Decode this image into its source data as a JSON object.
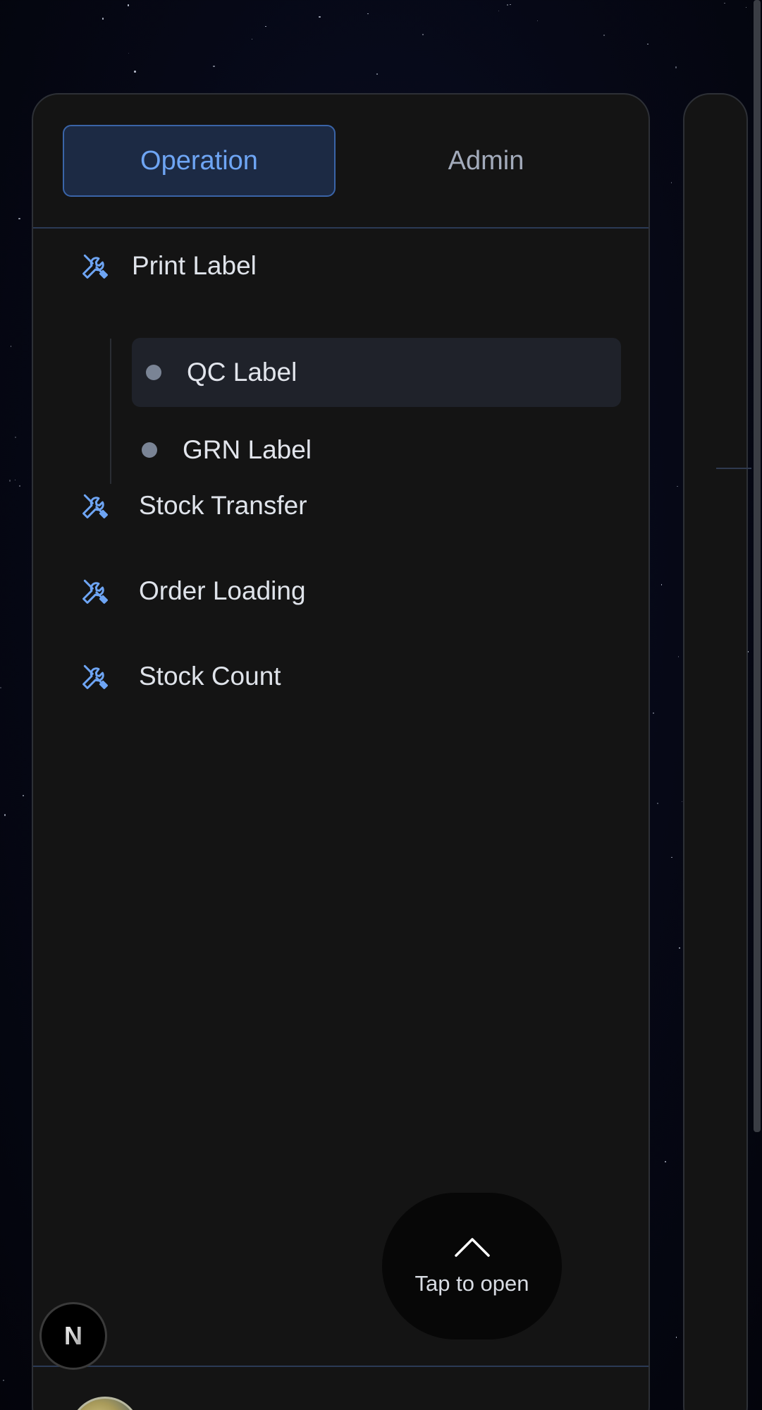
{
  "tabs": {
    "operation": "Operation",
    "admin": "Admin"
  },
  "menu": {
    "print_label": "Print Label",
    "sub_items": [
      "QC Label",
      "GRN Label"
    ],
    "stock_transfer": "Stock Transfer",
    "order_loading": "Order Loading",
    "stock_count": "Stock Count"
  },
  "fab": {
    "label": "Tap to open",
    "icon": "chevron-up-icon"
  },
  "badge": {
    "letter": "N"
  },
  "icons": {
    "menu_item": "tools-icon",
    "sub_item": "dot-icon"
  },
  "colors": {
    "accent": "#6ea5f4",
    "active_tab_bg": "#1c2a44",
    "panel_bg": "#141414"
  }
}
